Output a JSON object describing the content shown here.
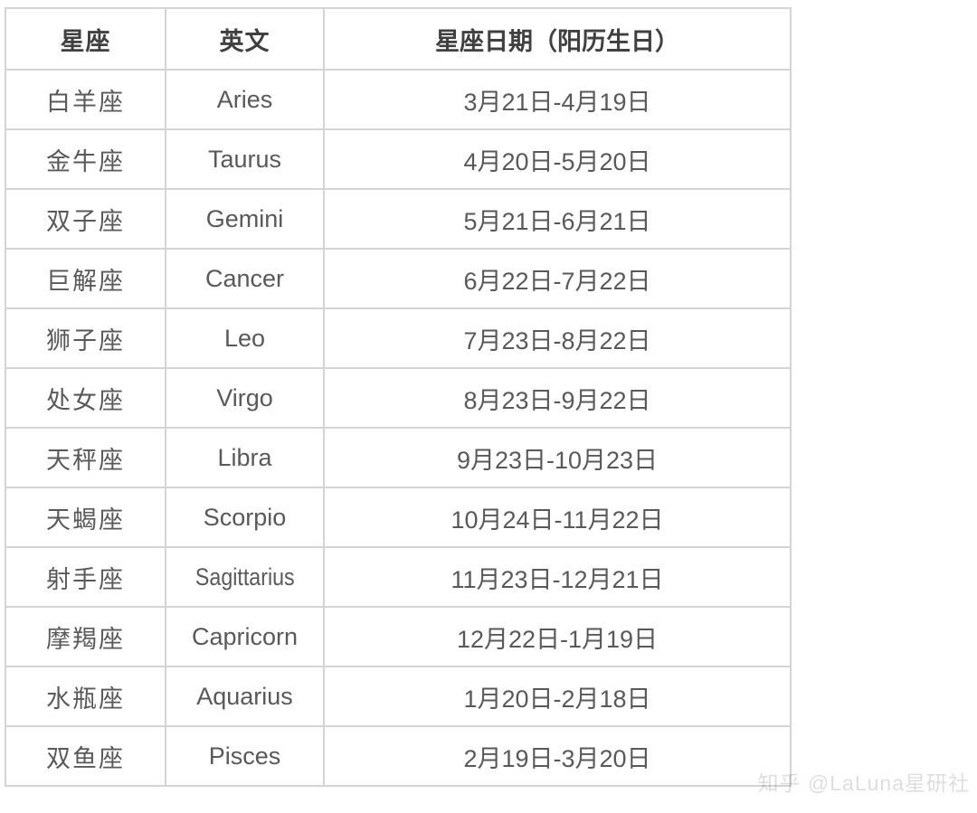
{
  "table": {
    "name": "zodiac-date-table",
    "columns": [
      {
        "key": "sign",
        "header": "星座"
      },
      {
        "key": "english",
        "header": "英文"
      },
      {
        "key": "dates",
        "header": "星座日期（阳历生日）"
      }
    ],
    "rows": [
      {
        "sign": "白羊座",
        "english": "Aries",
        "dates": "3月21日-4月19日"
      },
      {
        "sign": "金牛座",
        "english": "Taurus",
        "dates": "4月20日-5月20日"
      },
      {
        "sign": "双子座",
        "english": "Gemini",
        "dates": "5月21日-6月21日"
      },
      {
        "sign": "巨解座",
        "english": "Cancer",
        "dates": "6月22日-7月22日"
      },
      {
        "sign": "狮子座",
        "english": "Leo",
        "dates": "7月23日-8月22日"
      },
      {
        "sign": "处女座",
        "english": "Virgo",
        "dates": "8月23日-9月22日"
      },
      {
        "sign": "天秤座",
        "english": "Libra",
        "dates": "9月23日-10月23日"
      },
      {
        "sign": "天蝎座",
        "english": "Scorpio",
        "dates": "10月24日-11月22日"
      },
      {
        "sign": "射手座",
        "english": "Sagittarius",
        "dates": "11月23日-12月21日"
      },
      {
        "sign": "摩羯座",
        "english": "Capricorn",
        "dates": "12月22日-1月19日"
      },
      {
        "sign": "水瓶座",
        "english": "Aquarius",
        "dates": "1月20日-2月18日"
      },
      {
        "sign": "双鱼座",
        "english": "Pisces",
        "dates": "2月19日-3月20日"
      }
    ]
  },
  "watermark": {
    "text": "知乎 @LaLuna星研社"
  },
  "colors": {
    "background": "#ffffff",
    "border": "#d4d4d4",
    "header_text": "#404040",
    "body_text": "#595959"
  }
}
